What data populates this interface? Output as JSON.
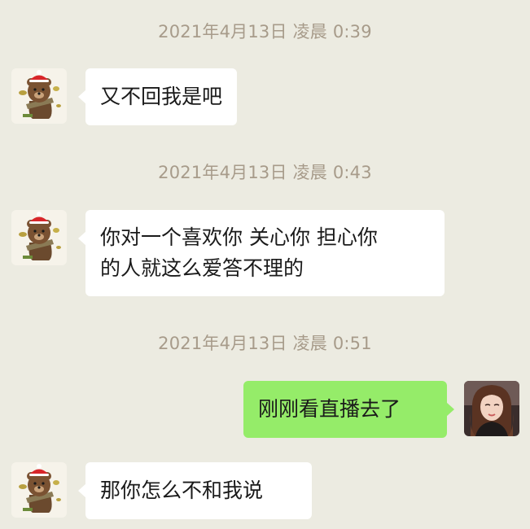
{
  "messages": [
    {
      "kind": "timestamp",
      "text": "2021年4月13日 凌晨 0:39"
    },
    {
      "kind": "message",
      "side": "incoming",
      "text": "又不回我是吧"
    },
    {
      "kind": "timestamp",
      "text": "2021年4月13日 凌晨 0:43"
    },
    {
      "kind": "message",
      "side": "incoming",
      "text": "你对一个喜欢你 关心你 担心你\n的人就这么爱答不理的"
    },
    {
      "kind": "timestamp",
      "text": "2021年4月13日 凌晨 0:51"
    },
    {
      "kind": "message",
      "side": "outgoing",
      "text": "刚刚看直播去了"
    },
    {
      "kind": "message",
      "side": "incoming",
      "text": "那你怎么不和我说"
    }
  ],
  "avatars": {
    "contact": "brown-bear-avatar",
    "self": "girl-photo-avatar"
  },
  "colors": {
    "background": "#ecebe1",
    "incoming_bubble": "#ffffff",
    "outgoing_bubble": "#95ec69",
    "timestamp_text": "#a79b8a"
  }
}
